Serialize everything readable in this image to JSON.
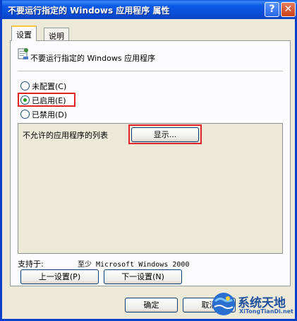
{
  "window": {
    "title": "不要运行指定的 Windows 应用程序 属性",
    "help_button": "?",
    "close_button": "✕"
  },
  "tabs": [
    {
      "label": "设置",
      "active": true
    },
    {
      "label": "说明",
      "active": false
    }
  ],
  "policy": {
    "name": "不要运行指定的 Windows 应用程序",
    "icon": "policy-icon"
  },
  "radio_options": [
    {
      "label": "未配置(C)",
      "checked": false
    },
    {
      "label": "已启用(E)",
      "checked": true
    },
    {
      "label": "已禁用(D)",
      "checked": false
    }
  ],
  "options": {
    "label": "不允许的应用程序的列表",
    "show_button": "显示..."
  },
  "supported": {
    "label": "支持于:",
    "value": "至少 Microsoft Windows 2000"
  },
  "nav": {
    "prev_button": "上一设置(P)",
    "next_button": "下一设置(N)"
  },
  "footer": {
    "ok_button": "确定",
    "cancel_button": "取消"
  },
  "watermark": {
    "text": "系统天地",
    "subtext": "XiTongTianDi.net"
  },
  "colors": {
    "titlebar": "#0a4fd8",
    "highlight": "#e0242a",
    "dialog_bg": "#ece9d8"
  }
}
